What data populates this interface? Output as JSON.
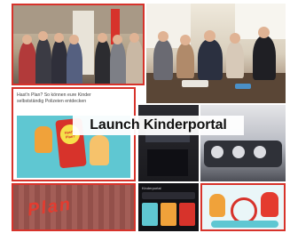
{
  "collage": {
    "title": "Launch Kinderportal",
    "article_headline": "Hast'n Plan? So können eure Kinder selbstständig Polizeien entdecken",
    "poster_text": "Hast'n Plan?",
    "street_marking_text": "Plan",
    "phone_screen_heading": "Kinderportal"
  },
  "colors": {
    "frame_red": "#d7332b",
    "accent_red": "#e43b2f",
    "cyan_panel": "#5fc7d2",
    "pavement": "#9f5750"
  }
}
